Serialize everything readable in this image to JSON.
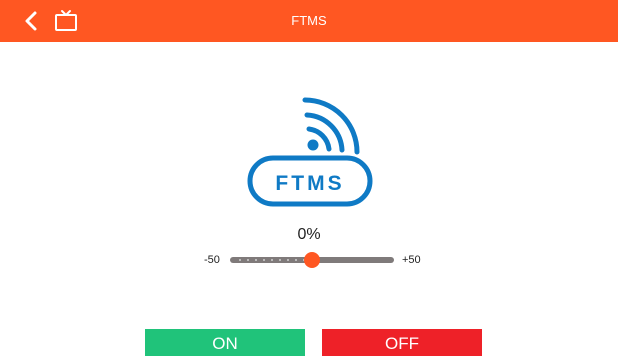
{
  "header": {
    "title": "FTMS",
    "back_icon": "chevron-left-icon",
    "tv_icon": "tv-icon"
  },
  "logo": {
    "text": "FTMS",
    "icon": "wifi-icon"
  },
  "slider": {
    "value_display": "0%",
    "min_label": "-50",
    "max_label": "+50",
    "min": -50,
    "max": 50,
    "value": 0
  },
  "buttons": {
    "on_label": "ON",
    "off_label": "OFF"
  },
  "colors": {
    "accent": "#ff5722",
    "on": "#20c37a",
    "off": "#ee2128",
    "logo_blue": "#0f7ac5",
    "track": "#7f7a7a"
  }
}
